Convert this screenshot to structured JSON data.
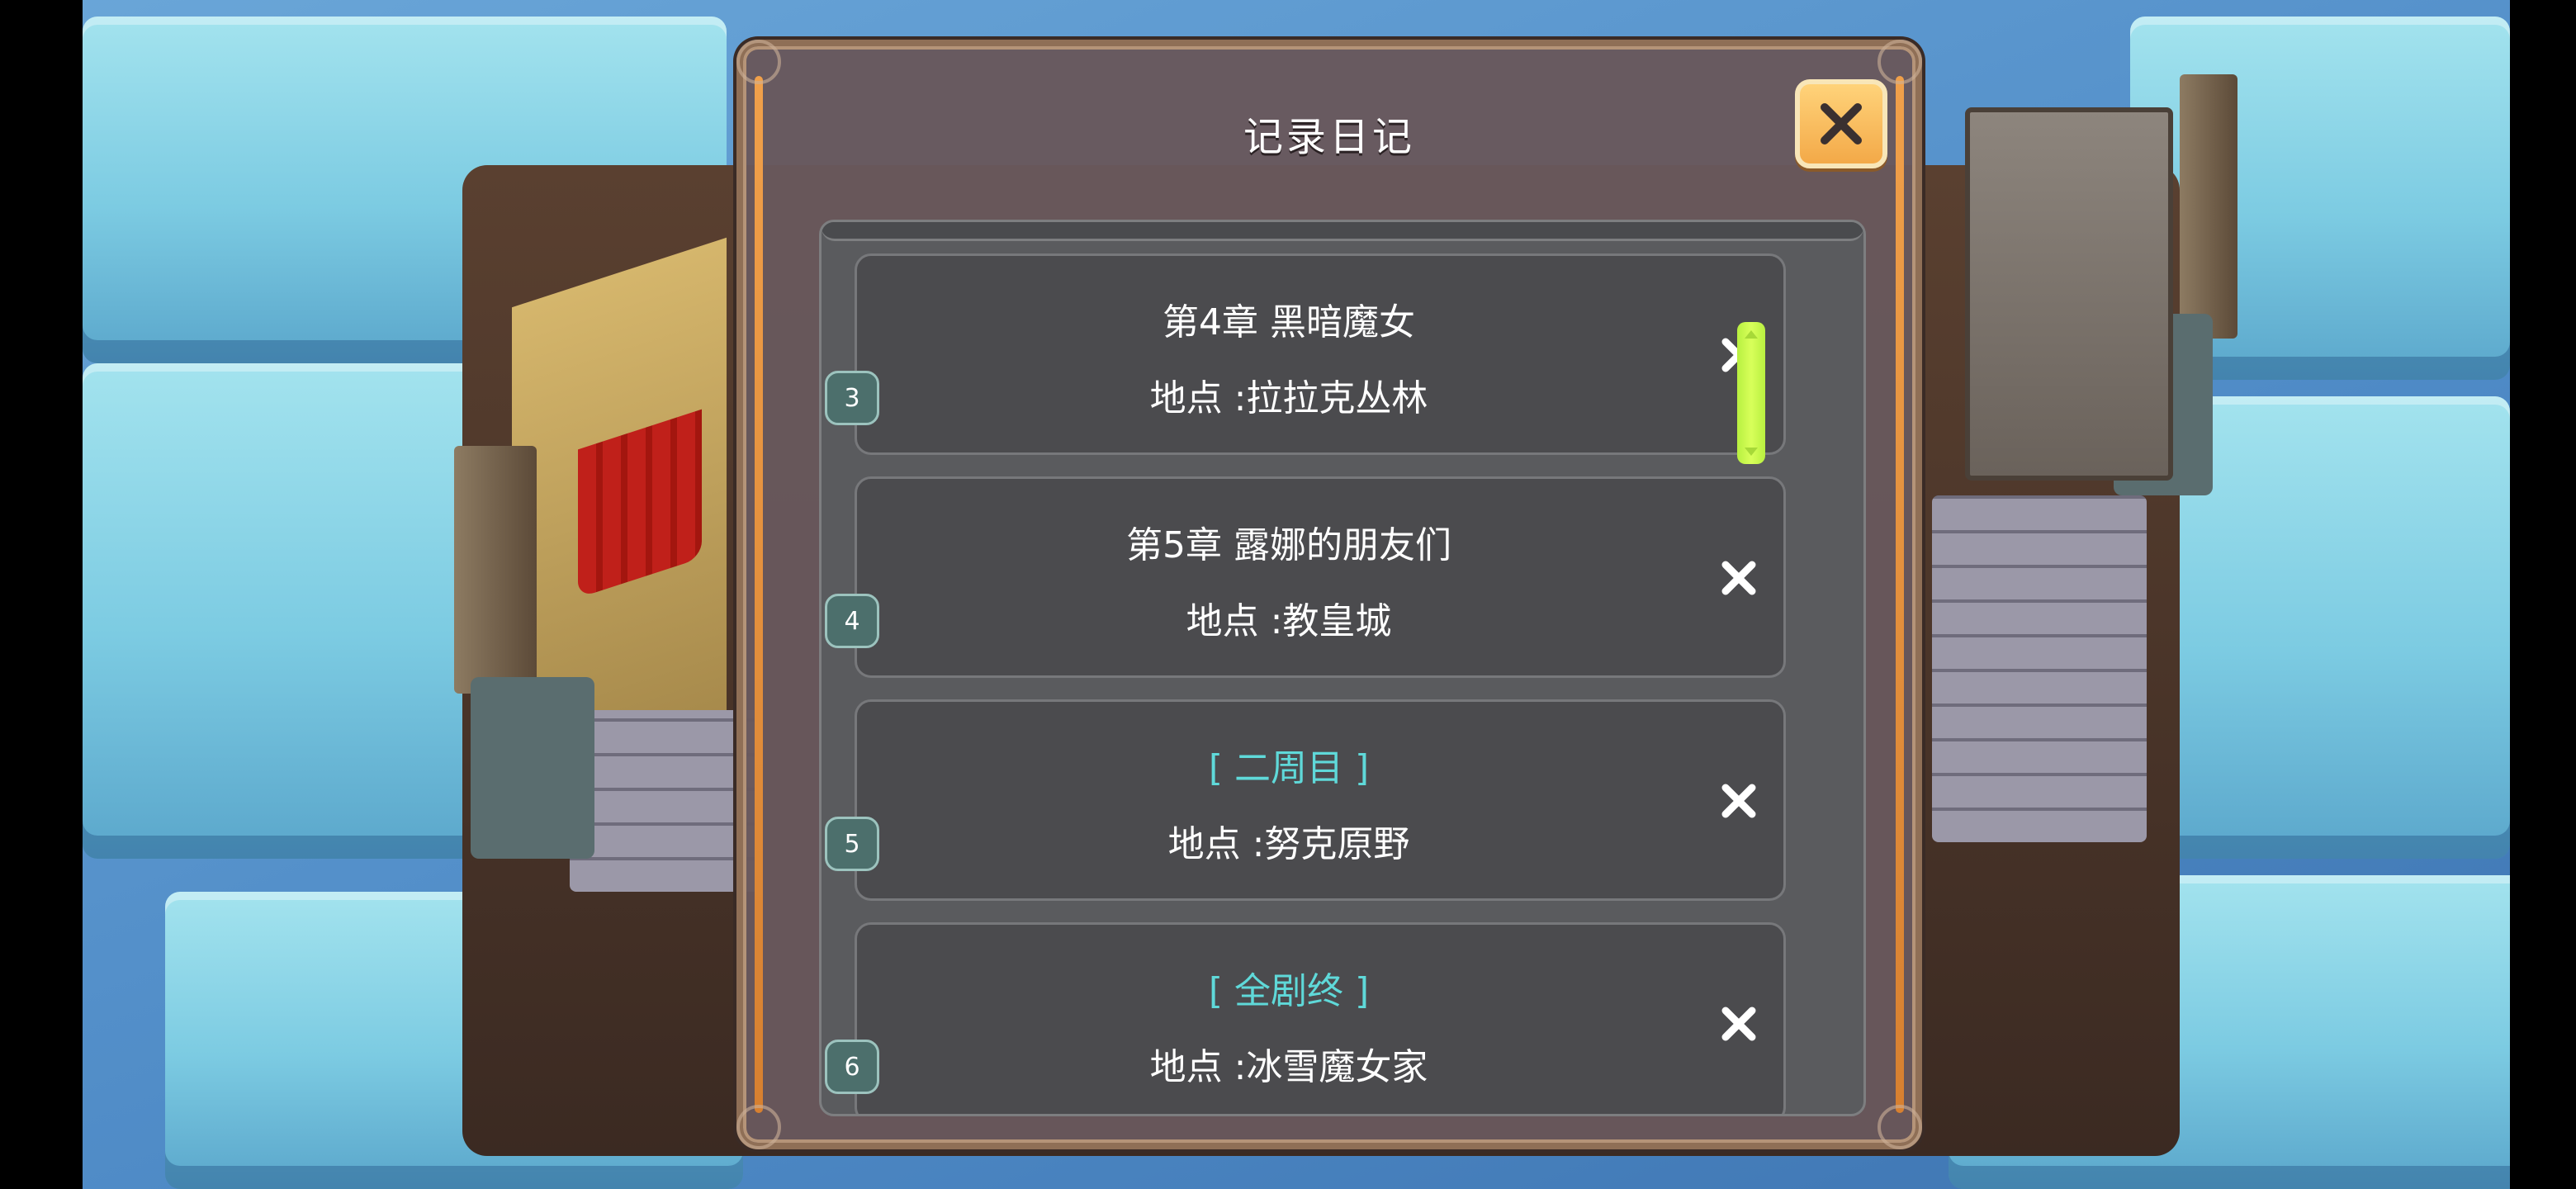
{
  "dialog": {
    "title": "记录日记",
    "close_icon": "close-icon"
  },
  "entries": [
    {
      "badge": "3",
      "title": "第4章 黑暗魔女",
      "location": "地点 :拉拉克丛林",
      "special": false,
      "delete_icon": "delete-x-icon"
    },
    {
      "badge": "4",
      "title": "第5章 露娜的朋友们",
      "location": "地点 :教皇城",
      "special": false,
      "delete_icon": "delete-x-icon"
    },
    {
      "badge": "5",
      "title": "[ 二周目 ]",
      "location": "地点 :努克原野",
      "special": true,
      "delete_icon": "delete-x-icon"
    },
    {
      "badge": "6",
      "title": "[ 全剧终 ]",
      "location": "地点 :冰雪魔女家",
      "special": true,
      "delete_icon": "delete-x-icon"
    }
  ],
  "scrollbar": {
    "position_fraction": 0.15
  },
  "colors": {
    "dialog_bg": "#68585c",
    "accent_orange": "#f0a04a",
    "close_button": "#f3a948",
    "special_title": "#5fd9d9",
    "badge_bg": "#4c6f6c",
    "scroll_thumb": "#c8f04c"
  }
}
